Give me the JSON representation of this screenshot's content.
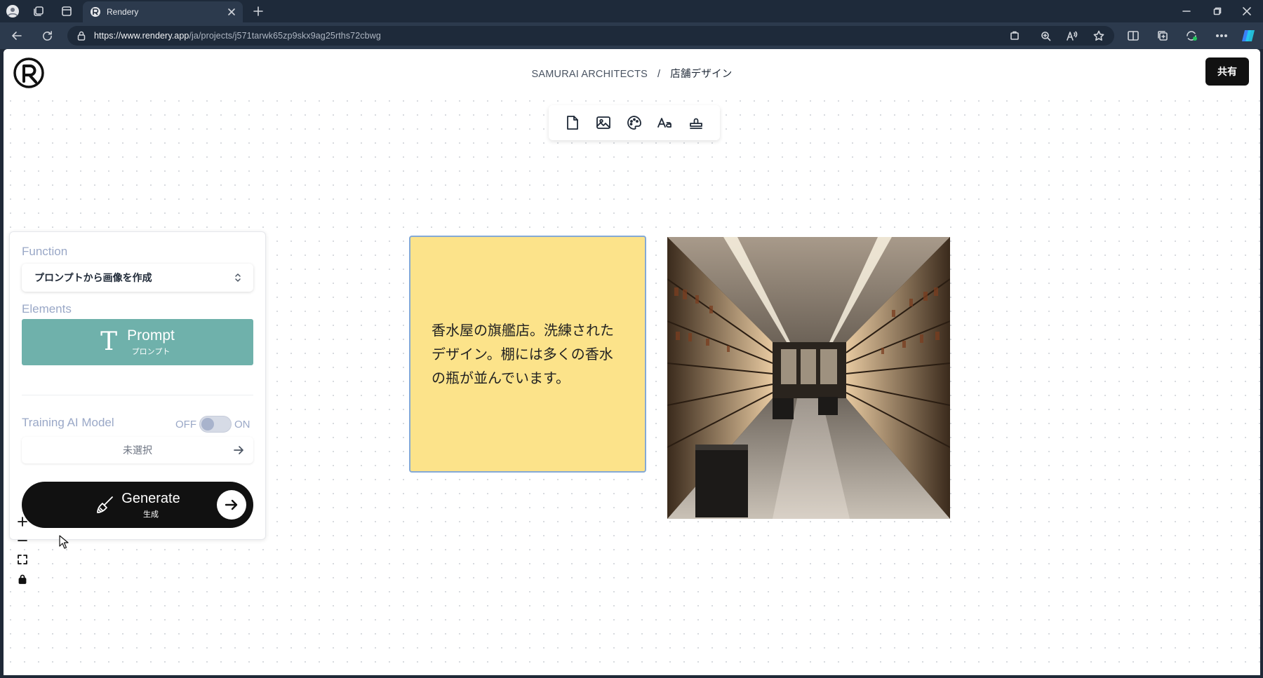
{
  "browser": {
    "tab_title": "Rendery",
    "url_host": "https://www.rendery.app",
    "url_path": "/ja/projects/j571tarwk65zp9skx9ag25rths72cbwg"
  },
  "header": {
    "breadcrumb_org": "SAMURAI ARCHITECTS",
    "breadcrumb_sep": "/",
    "breadcrumb_project": "店舗デザイン",
    "share_label": "共有"
  },
  "panel": {
    "function_label": "Function",
    "function_value": "プロンプトから画像を作成",
    "elements_label": "Elements",
    "prompt_title": "Prompt",
    "prompt_sub": "プロンプト",
    "training_label": "Training AI Model",
    "toggle_off": "OFF",
    "toggle_on": "ON",
    "toggle_state": "off",
    "model_value": "未選択",
    "generate_title": "Generate",
    "generate_sub": "生成"
  },
  "canvas": {
    "sticky_text": "香水屋の旗艦店。洗練されたデザイン。棚には多くの香水の瓶が並んでいます。"
  },
  "colors": {
    "prompt_bg": "#6fb1ab",
    "sticky_bg": "#fce38a",
    "sticky_border": "#84a9d6",
    "generate_bg": "#111111",
    "section_label": "#9aa8c7"
  }
}
